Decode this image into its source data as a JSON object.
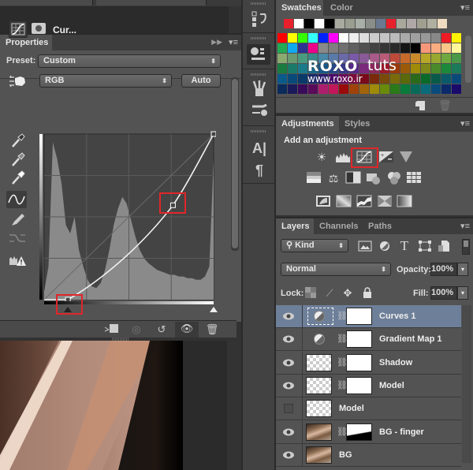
{
  "document": {
    "tabs": [
      {
        "label": ""
      },
      {
        "label": ""
      }
    ]
  },
  "properties": {
    "tab_label": "Properties",
    "title": "Cur...",
    "preset_label": "Preset:",
    "preset_value": "Custom",
    "channel_value": "RGB",
    "auto_label": "Auto",
    "tools": [
      "eyedropper-black-icon",
      "eyedropper-gray-icon",
      "eyedropper-white-icon",
      "curve-point-tool-icon",
      "pencil-icon",
      "smooth-icon",
      "clipping-warning-icon"
    ],
    "curve": {
      "points": [
        [
          0.14,
          0.0
        ],
        [
          0.76,
          0.57
        ],
        [
          1.0,
          1.0
        ]
      ],
      "active_tool": "curve-point-tool"
    },
    "footer_buttons": [
      "clip-to-layer",
      "view-previous-state",
      "reset",
      "toggle-visibility",
      "delete"
    ]
  },
  "swatches": {
    "tabs": [
      "Swatches",
      "Color"
    ],
    "recent": [
      "#e8202c",
      "#ffffff",
      "#000000",
      "#ffffff",
      "#000000",
      "#a8aaa0",
      "#9a9e90",
      "#a8b0a8",
      "#8a8e88",
      "#6a7890",
      "#e8202c",
      "#a8a89c",
      "#b0a8a8",
      "#a0a090",
      "#b0b0a0",
      "#f0dcc0"
    ],
    "rows": [
      [
        "#ff0000",
        "#ffff00",
        "#33ff00",
        "#33ffff",
        "#0022ff",
        "#ff00ff",
        "#ffffff",
        "#eeeeee",
        "#dddddd",
        "#cccccc",
        "#c4c4c4",
        "#bbbbbb",
        "#aaaaaa",
        "#a0a0a0",
        "#999999",
        "#888888",
        "#ee1c25",
        "#fff200"
      ],
      [
        "#22aa55",
        "#11aaee",
        "#2e3192",
        "#ec008c",
        "#8a8a8a",
        "#7f7f7f",
        "#707070",
        "#606060",
        "#505050",
        "#424242",
        "#363636",
        "#2a2a2a",
        "#151515",
        "#000000",
        "#f7977a",
        "#f9ad81",
        "#fdc689",
        "#fff79a"
      ],
      [
        "#8aaa70",
        "#6a9a70",
        "#4a9a80",
        "#3a8a8a",
        "#4a88a8",
        "#5a7aa8",
        "#6a6aa8",
        "#7a5aa8",
        "#8a5a98",
        "#a85a88",
        "#b85a78",
        "#c04a3a",
        "#c86a2a",
        "#c88a2a",
        "#b8a828",
        "#98a830",
        "#70a840",
        "#4a9848"
      ],
      [
        "#1a7a40",
        "#1a7a6a",
        "#1a7a8a",
        "#1a6a8a",
        "#1a5a8a",
        "#2a4a8a",
        "#3a3a8a",
        "#5a2a8a",
        "#7a2a7a",
        "#8a2a5a",
        "#9a1a2a",
        "#9a3a0a",
        "#9a5a0a",
        "#a08a0a",
        "#808a1a",
        "#4a8a2a",
        "#1a8a3a",
        "#1a7a5a"
      ],
      [
        "#0a5a8a",
        "#0a4a7a",
        "#0a3a6a",
        "#1a2a6a",
        "#2a1a6a",
        "#4a0a6a",
        "#6a0a5a",
        "#7a0a3a",
        "#7a0a1a",
        "#7a2a0a",
        "#7a4a0a",
        "#7a6a0a",
        "#5a6a0a",
        "#2a6a1a",
        "#0a6a2a",
        "#0a5a4a",
        "#0a5a6a",
        "#0a4a7a"
      ],
      [
        "#0a2a5a",
        "#1a1a5a",
        "#3a0a5a",
        "#5a0a5a",
        "#ae1e6e",
        "#c2185b",
        "#9a0a0a",
        "#a0420a",
        "#a0640a",
        "#a08a0a",
        "#6a8a0a",
        "#2a7a1a",
        "#0a7a3a",
        "#0a6a5a",
        "#0a6a7a",
        "#0a4a7a",
        "#0a2a6a",
        "#1a0a6a"
      ]
    ],
    "watermark": {
      "brand": "ROXO",
      "suffix": "tuts",
      "url": "www.roxo.ir"
    }
  },
  "adjustments": {
    "tabs": [
      "Adjustments",
      "Styles"
    ],
    "title": "Add an adjustment",
    "row1": [
      "brightness-contrast-icon",
      "levels-icon",
      "curves-icon",
      "exposure-icon",
      "vibrance-icon"
    ],
    "row2": [
      "hue-saturation-icon",
      "color-balance-icon",
      "black-white-icon",
      "photo-filter-icon",
      "channel-mixer-icon",
      "color-lookup-icon"
    ],
    "row3": [
      "invert-icon",
      "posterize-icon",
      "threshold-icon",
      "selective-color-icon",
      "gradient-map-icon"
    ],
    "highlighted": "curves-icon"
  },
  "layers": {
    "tabs": [
      "Layers",
      "Channels",
      "Paths"
    ],
    "filter_kind": "Kind",
    "blend_mode": "Normal",
    "opacity_label": "Opacity:",
    "opacity": "100%",
    "lock_label": "Lock:",
    "fill_label": "Fill:",
    "fill": "100%",
    "items": [
      {
        "name": "Curves 1",
        "visible": true,
        "type": "adjustment",
        "mask": true,
        "selected": true
      },
      {
        "name": "Gradient Map 1",
        "visible": true,
        "type": "adjustment",
        "mask": true,
        "selected": false
      },
      {
        "name": "Shadow",
        "visible": true,
        "type": "pixel",
        "mask": true,
        "selected": false
      },
      {
        "name": "Model",
        "visible": true,
        "type": "pixel",
        "mask": true,
        "selected": false
      },
      {
        "name": "Model",
        "visible": false,
        "type": "pixel",
        "mask": false,
        "selected": false
      },
      {
        "name": "BG - finger",
        "visible": true,
        "type": "photo",
        "mask": true,
        "selected": false
      },
      {
        "name": "BG",
        "visible": true,
        "type": "photo",
        "mask": false,
        "selected": false
      }
    ]
  }
}
